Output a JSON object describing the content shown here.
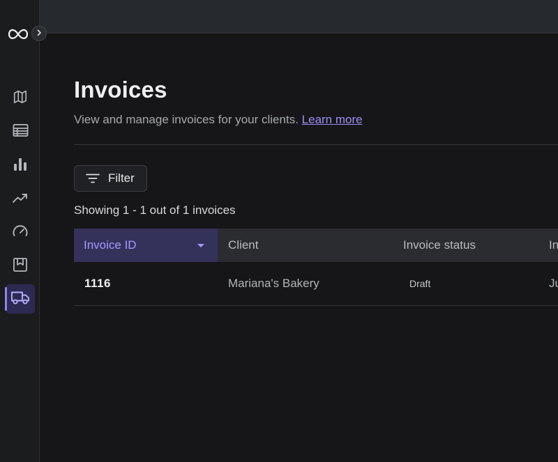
{
  "page": {
    "title": "Invoices",
    "subtitle": "View and manage invoices for your clients.",
    "learn_more": "Learn more"
  },
  "toolbar": {
    "filter_label": "Filter",
    "showing_text": "Showing 1 - 1 out of 1 invoices"
  },
  "sidebar": {
    "items": [
      {
        "icon": "map-icon",
        "active": false
      },
      {
        "icon": "table-icon",
        "active": false
      },
      {
        "icon": "bar-chart-icon",
        "active": false
      },
      {
        "icon": "trend-line-icon",
        "active": false
      },
      {
        "icon": "speedometer-icon",
        "active": false
      },
      {
        "icon": "bookmark-icon",
        "active": false
      },
      {
        "icon": "truck-icon",
        "active": true
      }
    ]
  },
  "table": {
    "columns": [
      "Invoice ID",
      "Client",
      "Invoice status",
      "In"
    ],
    "sorted_column": "Invoice ID",
    "rows": [
      {
        "id": "1116",
        "client": "Mariana's Bakery",
        "status": "Draft",
        "next": "Ju"
      }
    ]
  },
  "colors": {
    "accent": "#8f84f2",
    "accent_text": "#a598ff",
    "link": "#9b8ff6",
    "background": "#161618",
    "sidebar": "#1b1c1e",
    "topbar": "#262a2f",
    "header_row": "#2b2c2f",
    "sorted_header": "#34325a"
  }
}
